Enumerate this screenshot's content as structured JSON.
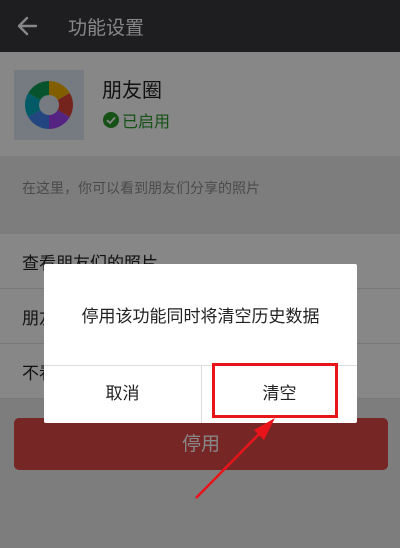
{
  "topbar": {
    "title": "功能设置",
    "back_icon": "arrow-left-icon"
  },
  "app": {
    "name": "朋友圈",
    "status": "已启用",
    "icon": "camera-aperture-icon"
  },
  "description": "在这里，你可以看到朋友们分享的照片",
  "list": [
    {
      "label": "查看朋友们的照片"
    },
    {
      "label": "朋友圈"
    },
    {
      "label": "不看"
    }
  ],
  "disable_button": "停用",
  "dialog": {
    "message": "停用该功能同时将清空历史数据",
    "cancel": "取消",
    "confirm": "清空"
  },
  "colors": {
    "topbar": "#393a3f",
    "status_green": "#2a9b2a",
    "danger": "#e04848",
    "highlight": "#e8141a"
  }
}
